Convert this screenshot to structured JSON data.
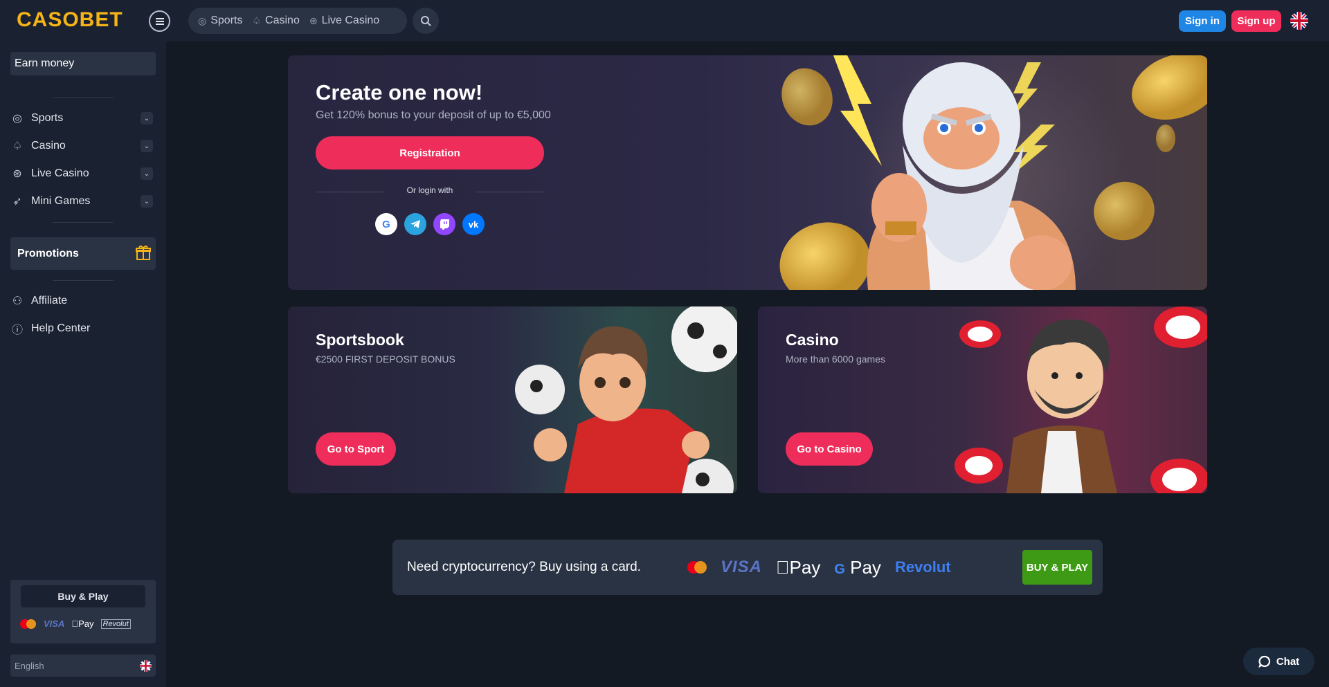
{
  "header": {
    "logo": "CASOBET",
    "nav": [
      {
        "label": "Sports",
        "icon": "basketball-icon"
      },
      {
        "label": "Casino",
        "icon": "spade-icon"
      },
      {
        "label": "Live Casino",
        "icon": "live-icon"
      }
    ],
    "signin_label": "Sign in",
    "signup_label": "Sign up"
  },
  "sidebar": {
    "earn_label": "Earn money",
    "items": [
      {
        "label": "Sports",
        "icon": "basketball-icon"
      },
      {
        "label": "Casino",
        "icon": "spade-icon"
      },
      {
        "label": "Live Casino",
        "icon": "live-icon"
      },
      {
        "label": "Mini Games",
        "icon": "rocket-icon"
      }
    ],
    "promotions_label": "Promotions",
    "links": [
      {
        "label": "Affiliate",
        "icon": "affiliate-icon"
      },
      {
        "label": "Help Center",
        "icon": "help-icon"
      }
    ],
    "buyplay_label": "Buy & Play",
    "pay_visa": "VISA",
    "pay_apple": "Pay",
    "pay_revolut": "Revolut",
    "language": "English"
  },
  "hero": {
    "title": "Create one now!",
    "subtitle": "Get 120% bonus to your deposit of up to €5,000",
    "register_label": "Registration",
    "or_login": "Or login with"
  },
  "cards": {
    "sport": {
      "title": "Sportsbook",
      "subtitle": "€2500 FIRST DEPOSIT BONUS",
      "button": "Go to Sport"
    },
    "casino": {
      "title": "Casino",
      "subtitle": "More than 6000 games",
      "button": "Go to Casino"
    }
  },
  "crypto": {
    "text": "Need cryptocurrency? Buy using a card.",
    "visa": "VISA",
    "apple_pay": "Pay",
    "google_pay": "Pay",
    "revolut": "Revolut",
    "button": "BUY & PLAY"
  },
  "chat_label": "Chat",
  "colors": {
    "accent": "#ef2d5b",
    "blue": "#1f86e6",
    "gold": "#f5b417",
    "green": "#3e9a14"
  }
}
